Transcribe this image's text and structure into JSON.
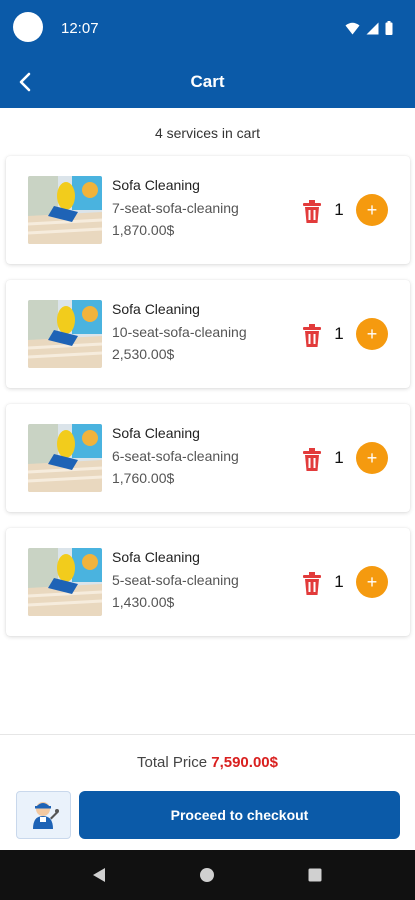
{
  "status_bar": {
    "time": "12:07",
    "icons": [
      "wifi-icon",
      "signal-icon",
      "battery-icon"
    ]
  },
  "app_bar": {
    "title": "Cart",
    "back_icon": "back-arrow-icon"
  },
  "cart": {
    "count_text": "4 services in cart",
    "items": [
      {
        "name": "Sofa Cleaning",
        "variant": "7-seat-sofa-cleaning",
        "price": "1,870.00$",
        "quantity": "1",
        "add_label": "+"
      },
      {
        "name": "Sofa Cleaning",
        "variant": "10-seat-sofa-cleaning",
        "price": "2,530.00$",
        "quantity": "1",
        "add_label": "+"
      },
      {
        "name": "Sofa Cleaning",
        "variant": "6-seat-sofa-cleaning",
        "price": "1,760.00$",
        "quantity": "1",
        "add_label": "+"
      },
      {
        "name": "Sofa Cleaning",
        "variant": "5-seat-sofa-cleaning",
        "price": "1,430.00$",
        "quantity": "1",
        "add_label": "+"
      }
    ]
  },
  "footer": {
    "total_label": "Total Price",
    "total_value": "7,590.00$",
    "checkout_label": "Proceed to checkout",
    "support_icon": "technician-icon"
  },
  "nav": {
    "icons": [
      "nav-back-icon",
      "nav-home-icon",
      "nav-recents-icon"
    ]
  },
  "colors": {
    "primary": "#0b5aa8",
    "accent": "#f59a0f",
    "danger": "#d9201f",
    "nav_bar": "#111111"
  }
}
